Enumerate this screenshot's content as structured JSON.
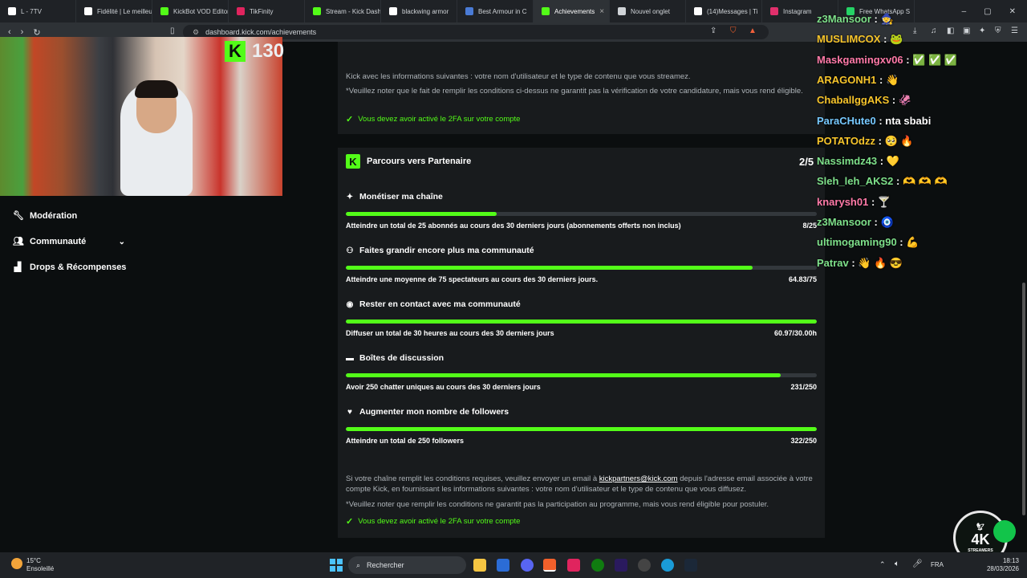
{
  "tabs": [
    {
      "label": "L - 7TV",
      "color": "#ffffff"
    },
    {
      "label": "Fidélité | Le meilleur",
      "color": "#ffffff"
    },
    {
      "label": "KickBot VOD Editor",
      "color": "#53fc18"
    },
    {
      "label": "TikFinity",
      "color": "#e0245e"
    },
    {
      "label": "Stream - Kick Dash",
      "color": "#53fc18"
    },
    {
      "label": "blackwing armor",
      "color": "#ffffff"
    },
    {
      "label": "Best Armour in C",
      "color": "#4a7bd6"
    },
    {
      "label": "Achievements",
      "color": "#53fc18",
      "active": true
    },
    {
      "label": "Nouvel onglet",
      "color": "#cfd3d7"
    },
    {
      "label": "(14)Messages | Ti",
      "color": "#ffffff"
    },
    {
      "label": "Instagram",
      "color": "#e1306c"
    },
    {
      "label": "Free WhatsApp S",
      "color": "#25d366"
    }
  ],
  "browser": {
    "url": "dashboard.kick.com/achievements"
  },
  "webcam": {
    "follower_count": "130"
  },
  "sidebar": {
    "items": [
      {
        "label": "Modération",
        "icon": "wrench-icon"
      },
      {
        "label": "Communauté",
        "icon": "users-icon"
      },
      {
        "label": "Drops & Récompenses",
        "icon": "chart-icon"
      }
    ]
  },
  "top_card": {
    "line1": "Kick avec les informations suivantes : votre nom d'utilisateur et le type de contenu que vous streamez.",
    "line2": "*Veuillez noter que le fait de remplir les conditions ci-dessus ne garantit pas la vérification de votre candidature, mais vous rend éligible.",
    "requirement": "Vous devez avoir activé le 2FA sur votre compte"
  },
  "partner": {
    "title": "Parcours vers Partenaire",
    "progress": "2/5",
    "sections": [
      {
        "title": "Monétiser ma chaîne",
        "icon": "sparkle-icon",
        "requirement": "Atteindre un total de 25 abonnés au cours des 30 derniers jours (abonnements offerts non inclus)",
        "value": "8/25",
        "fill": 0.32
      },
      {
        "title": "Faites grandir encore plus ma communauté",
        "icon": "users-plus-icon",
        "requirement": "Atteindre une moyenne de 75 spectateurs au cours des 30 derniers jours.",
        "value": "64.83/75",
        "fill": 0.8644
      },
      {
        "title": "Rester en contact avec ma communauté",
        "icon": "broadcast-icon",
        "requirement": "Diffuser un total de 30 heures au cours des 30 derniers jours",
        "value": "60.97/30.00h",
        "fill": 1.0
      },
      {
        "title": "Boîtes de discussion",
        "icon": "chat-icon",
        "requirement": "Avoir 250 chatter uniques au cours des 30 derniers jours",
        "value": "231/250",
        "fill": 0.924
      },
      {
        "title": "Augmenter mon nombre de followers",
        "icon": "heart-icon",
        "requirement": "Atteindre un total de 250 followers",
        "value": "322/250",
        "fill": 1.0
      }
    ],
    "footer_line1_pre": "Si votre chaîne remplit les conditions requises, veuillez envoyer un email à ",
    "footer_email": "kickpartners@kick.com",
    "footer_line1_post": " depuis l'adresse email associée à votre compte Kick, en fournissant les informations suivantes : votre nom d'utilisateur et le type de contenu que vous diffusez.",
    "footer_line2": "*Veuillez noter que remplir les conditions ne garantit pas la participation au programme, mais vous rend éligible pour postuler.",
    "footer_requirement": "Vous devez avoir activé le 2FA sur votre compte"
  },
  "chat": [
    {
      "user": "z3Mansoor",
      "color": "#7ee08a",
      "msg": "🧙"
    },
    {
      "user": "MUSLIMCOX",
      "color": "#f7c52b",
      "msg": "🐸"
    },
    {
      "user": "Maskgamingxv06",
      "color": "#ff7aa8",
      "msg": "✅ ✅ ✅"
    },
    {
      "user": "ARAGONH1",
      "color": "#f7c52b",
      "msg": "👋"
    },
    {
      "user": "ChaballggAKS",
      "color": "#f7c52b",
      "msg": "🦑"
    },
    {
      "user": "ParaCHute0",
      "color": "#76c9ff",
      "msg": "nta sbabi"
    },
    {
      "user": "POTATOdzz",
      "color": "#f7c52b",
      "msg": "🥺 🔥"
    },
    {
      "user": "Nassimdz43",
      "color": "#7ee08a",
      "msg": "💛"
    },
    {
      "user": "Sleh_leh_AKS2",
      "color": "#7ee08a",
      "msg": "🫶 🫶 🫶"
    },
    {
      "user": "knarysh01",
      "color": "#ff7aa8",
      "msg": "🍸"
    },
    {
      "user": "z3Mansoor",
      "color": "#7ee08a",
      "msg": "🧿"
    },
    {
      "user": "ultimogaming90",
      "color": "#7ee08a",
      "msg": "💪"
    },
    {
      "user": "Patrav",
      "color": "#7ee08a",
      "msg": "👋 🔥 😎"
    }
  ],
  "taskbar": {
    "weather_temp": "15°C",
    "weather_desc": "Ensoleillé",
    "search_placeholder": "Rechercher",
    "lang": "FRA",
    "time": "18:13",
    "date": "28/03/2026"
  },
  "overlay_logo": {
    "text": "4K",
    "sub": "STREAMERS"
  }
}
